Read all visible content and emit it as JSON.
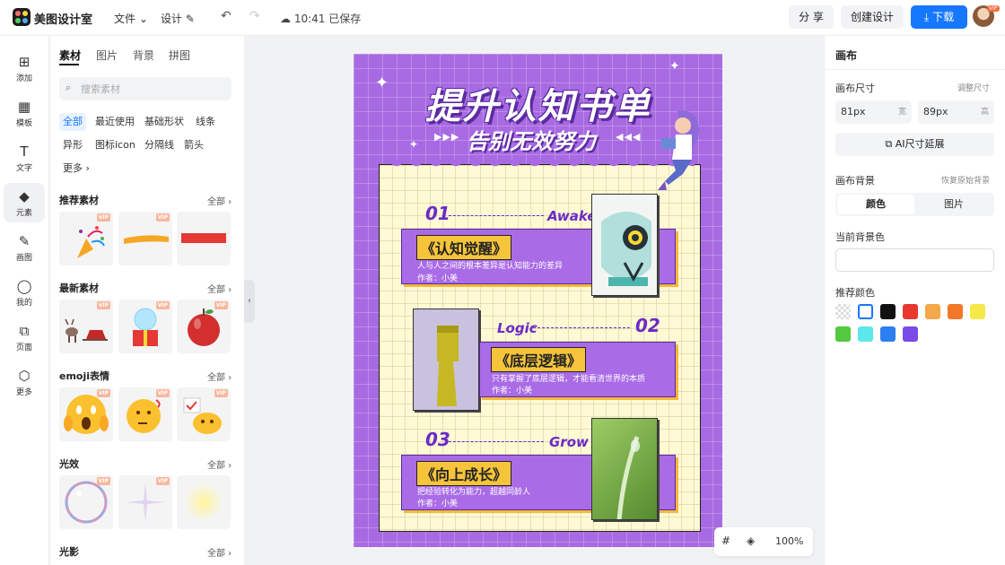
{
  "topbar": {
    "app_name": "美图设计室",
    "menu_file": "文件",
    "menu_design": "设计",
    "save_status": "10:41 已保存",
    "share": "分 享",
    "create": "创建设计",
    "download": "下载",
    "avatar_vip": "VIP"
  },
  "nav": [
    {
      "label": "添加",
      "icon": "plus-square-icon",
      "glyph": "⊞"
    },
    {
      "label": "模板",
      "icon": "template-icon",
      "glyph": "▦"
    },
    {
      "label": "文字",
      "icon": "text-icon",
      "glyph": "T"
    },
    {
      "label": "元素",
      "icon": "shapes-icon",
      "glyph": "◆"
    },
    {
      "label": "画图",
      "icon": "draw-icon",
      "glyph": "✎"
    },
    {
      "label": "我的",
      "icon": "user-icon",
      "glyph": "◯"
    },
    {
      "label": "页面",
      "icon": "page-icon",
      "glyph": "⧉"
    },
    {
      "label": "更多",
      "icon": "cube-icon",
      "glyph": "⬡"
    }
  ],
  "panel": {
    "tabs": [
      "素材",
      "图片",
      "背景",
      "拼图"
    ],
    "search_placeholder": "搜索素材",
    "chips": [
      "全部",
      "最近使用",
      "基础形状",
      "线条",
      "异形",
      "图标icon",
      "分隔线",
      "箭头",
      "更多"
    ],
    "all_label": "全部",
    "vip_label": "VIP",
    "sections": [
      "推荐素材",
      "最新素材",
      "emoji表情",
      "光效",
      "光影"
    ]
  },
  "poster": {
    "title": "提升认知书单",
    "subtitle": "告别无效努力",
    "items": [
      {
        "num": "01",
        "eng": "Awake",
        "book": "《认知觉醒》",
        "desc": "人与人之间的根本差异是认知能力的差异",
        "author": "作者：小美"
      },
      {
        "num": "02",
        "eng": "Logic",
        "book": "《底层逻辑》",
        "desc": "只有掌握了底层逻辑，才能看清世界的本质",
        "author": "作者：小美"
      },
      {
        "num": "03",
        "eng": "Grow",
        "book": "《向上成长》",
        "desc": "把经验转化为能力，超越同龄人",
        "author": "作者：小美"
      }
    ]
  },
  "right": {
    "title": "画布",
    "size_label": "画布尺寸",
    "adjust_size": "调整尺寸",
    "width_value": "81px",
    "width_unit": "宽",
    "height_value": "89px",
    "height_unit": "高",
    "ai_extend": "AI尺寸延展",
    "bg_label": "画布背景",
    "restore_bg": "恢复原始背景",
    "seg_color": "颜色",
    "seg_image": "图片",
    "current_bg": "当前背景色",
    "recommended": "推荐颜色",
    "swatches": [
      "transparent",
      "#ffffff",
      "#111111",
      "#e8382f",
      "#f5a84a",
      "#f07828",
      "#f5e94a",
      "#52c93f",
      "#5ce8ea",
      "#2b7ff0",
      "#7a4be8"
    ]
  },
  "zoom": {
    "value": "100%"
  }
}
